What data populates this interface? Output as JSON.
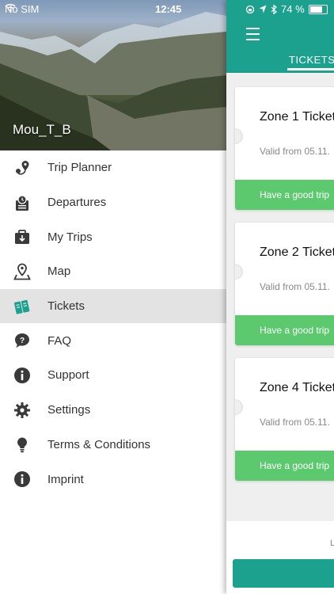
{
  "status_bar": {
    "carrier": "No SIM",
    "time": "12:45",
    "battery": "74 %"
  },
  "drawer": {
    "username": "Mou_T_B",
    "items": [
      {
        "label": "Trip Planner",
        "icon": "route-pin-icon",
        "active": false
      },
      {
        "label": "Departures",
        "icon": "clock-list-icon",
        "active": false
      },
      {
        "label": "My Trips",
        "icon": "briefcase-icon",
        "active": false
      },
      {
        "label": "Map",
        "icon": "map-pin-icon",
        "active": false
      },
      {
        "label": "Tickets",
        "icon": "tickets-icon",
        "active": true
      },
      {
        "label": "FAQ",
        "icon": "question-bubble-icon",
        "active": false
      },
      {
        "label": "Support",
        "icon": "info-icon",
        "active": false
      },
      {
        "label": "Settings",
        "icon": "gear-icon",
        "active": false
      },
      {
        "label": "Terms & Conditions",
        "icon": "lightbulb-icon",
        "active": false
      },
      {
        "label": "Imprint",
        "icon": "info-icon",
        "active": false
      }
    ]
  },
  "content": {
    "tab_label": "TICKETS",
    "cards": [
      {
        "title": "Zone 1 Ticket",
        "valid": "Valid from 05.11.",
        "footer": "Have a good trip"
      },
      {
        "title": "Zone 2 Ticket",
        "valid": "Valid from 05.11.",
        "footer": "Have a good trip"
      },
      {
        "title": "Zone 4 Ticket",
        "valid": "Valid from 05.11.",
        "footer": "Have a good trip"
      }
    ],
    "bottom_partial_text": "L"
  },
  "colors": {
    "brand_teal": "#1ca18f",
    "ticket_green": "#5cc96f",
    "active_row": "#e3e3e3",
    "icon_dark": "#3a3a3a",
    "active_icon": "#1ca18f"
  }
}
